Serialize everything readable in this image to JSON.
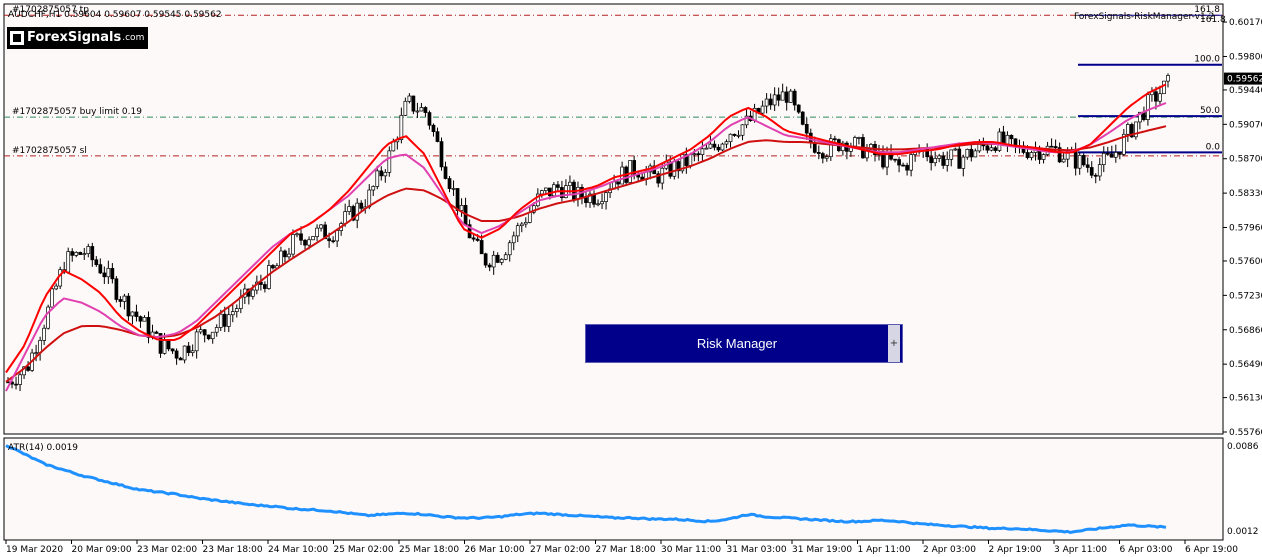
{
  "header": {
    "symbol_line": "AUDCHF,H1  0.59604 0.59607 0.59545 0.59562",
    "ea_label": "ForexSignals-RiskManager-v1.2",
    "ea_badge": "161.8"
  },
  "logo": {
    "text": "ForexSignals",
    "suffix": ".com"
  },
  "order_lines": [
    {
      "label": "#1702875057 tp",
      "price": 0.60244,
      "color": "#b22222"
    },
    {
      "label": "#1702875057 buy limit 0.19",
      "price": 0.59148,
      "color": "#2e8b57"
    },
    {
      "label": "#1702875057 sl",
      "price": 0.5873,
      "color": "#b22222"
    }
  ],
  "fib_levels": [
    {
      "label": "161.8",
      "price": 0.60244
    },
    {
      "label": "100.0",
      "price": 0.59711
    },
    {
      "label": "50.0",
      "price": 0.59158
    },
    {
      "label": "0.0",
      "price": 0.58768
    }
  ],
  "risk_manager": {
    "label": "Risk Manager",
    "plus": "+"
  },
  "indicator": {
    "label": "ATR(14) 0.0019",
    "max_label": "0.0086",
    "min_label": "0.0012"
  },
  "chart_data": {
    "type": "candlestick",
    "symbol": "AUDCHF,H1",
    "current_price": 0.59562,
    "current_price_label": "0.59562",
    "ylim": [
      0.5576,
      0.603
    ],
    "y_ticks": [
      "0.60170",
      "0.59800",
      "0.59440",
      "0.59070",
      "0.58700",
      "0.58330",
      "0.57960",
      "0.57600",
      "0.57230",
      "0.56860",
      "0.56490",
      "0.56130",
      "0.55760"
    ],
    "x_ticks": [
      "19 Mar 2020",
      "20 Mar 09:00",
      "23 Mar 02:00",
      "23 Mar 18:00",
      "24 Mar 10:00",
      "25 Mar 02:00",
      "25 Mar 18:00",
      "26 Mar 10:00",
      "27 Mar 02:00",
      "27 Mar 18:00",
      "30 Mar 11:00",
      "31 Mar 03:00",
      "31 Mar 19:00",
      "1 Apr 11:00",
      "2 Apr 03:00",
      "2 Apr 19:00",
      "3 Apr 11:00",
      "6 Apr 03:00",
      "6 Apr 19:00"
    ],
    "close_profile": [
      0.563,
      0.5645,
      0.57,
      0.576,
      0.577,
      0.575,
      0.572,
      0.5695,
      0.567,
      0.566,
      0.568,
      0.569,
      0.571,
      0.573,
      0.575,
      0.578,
      0.579,
      0.579,
      0.581,
      0.583,
      0.587,
      0.593,
      0.592,
      0.586,
      0.58,
      0.576,
      0.577,
      0.58,
      0.583,
      0.584,
      0.583,
      0.583,
      0.585,
      0.586,
      0.585,
      0.586,
      0.587,
      0.588,
      0.59,
      0.591,
      0.593,
      0.594,
      0.589,
      0.588,
      0.589,
      0.588,
      0.587,
      0.586,
      0.588,
      0.587,
      0.587,
      0.588,
      0.589,
      0.588,
      0.588,
      0.588,
      0.587,
      0.586,
      0.587,
      0.59,
      0.593,
      0.595
    ],
    "ema_fast_profile": [
      0.564,
      0.567,
      0.572,
      0.575,
      0.574,
      0.5725,
      0.57,
      0.5685,
      0.5675,
      0.5675,
      0.569,
      0.571,
      0.573,
      0.575,
      0.577,
      0.579,
      0.58,
      0.5815,
      0.5835,
      0.586,
      0.5885,
      0.5895,
      0.5875,
      0.5835,
      0.5795,
      0.5785,
      0.5795,
      0.5815,
      0.583,
      0.5835,
      0.5835,
      0.584,
      0.585,
      0.5855,
      0.586,
      0.587,
      0.588,
      0.5895,
      0.5915,
      0.5925,
      0.5915,
      0.59,
      0.5895,
      0.589,
      0.5885,
      0.588,
      0.5875,
      0.5875,
      0.5878,
      0.588,
      0.5885,
      0.5888,
      0.5888,
      0.5884,
      0.5882,
      0.5878,
      0.5876,
      0.5885,
      0.5905,
      0.5925,
      0.594,
      0.595
    ],
    "ema_mid_profile": [
      0.562,
      0.566,
      0.57,
      0.572,
      0.5715,
      0.5705,
      0.569,
      0.568,
      0.5678,
      0.5682,
      0.5695,
      0.5715,
      0.5735,
      0.5755,
      0.5775,
      0.579,
      0.58,
      0.5815,
      0.583,
      0.585,
      0.587,
      0.5875,
      0.586,
      0.583,
      0.58,
      0.579,
      0.5798,
      0.5812,
      0.5825,
      0.583,
      0.5832,
      0.5838,
      0.5846,
      0.5852,
      0.5858,
      0.5866,
      0.5875,
      0.5888,
      0.5905,
      0.5915,
      0.5905,
      0.5895,
      0.5892,
      0.5888,
      0.5884,
      0.588,
      0.5877,
      0.5877,
      0.588,
      0.5883,
      0.5886,
      0.5888,
      0.5886,
      0.5883,
      0.588,
      0.5877,
      0.5877,
      0.5885,
      0.5898,
      0.5912,
      0.5922,
      0.593
    ],
    "ema_slow_profile": [
      0.563,
      0.5645,
      0.5665,
      0.5682,
      0.569,
      0.569,
      0.5686,
      0.568,
      0.5678,
      0.568,
      0.5688,
      0.57,
      0.5715,
      0.5732,
      0.5748,
      0.5762,
      0.5775,
      0.5788,
      0.5802,
      0.5818,
      0.583,
      0.5838,
      0.5836,
      0.5826,
      0.5812,
      0.5803,
      0.5803,
      0.5808,
      0.5816,
      0.5822,
      0.5826,
      0.5832,
      0.5838,
      0.5844,
      0.585,
      0.5856,
      0.5862,
      0.587,
      0.588,
      0.5888,
      0.589,
      0.5888,
      0.5888,
      0.5886,
      0.5884,
      0.5882,
      0.588,
      0.588,
      0.5881,
      0.5882,
      0.5884,
      0.5886,
      0.5886,
      0.5884,
      0.5882,
      0.588,
      0.5879,
      0.5882,
      0.5888,
      0.5895,
      0.59,
      0.5905
    ],
    "atr_profile": [
      0.0086,
      0.0078,
      0.007,
      0.0065,
      0.006,
      0.0056,
      0.0052,
      0.0048,
      0.0046,
      0.0044,
      0.0041,
      0.0039,
      0.0037,
      0.0035,
      0.0034,
      0.0032,
      0.0031,
      0.003,
      0.0028,
      0.0026,
      0.0027,
      0.0028,
      0.0027,
      0.0025,
      0.0024,
      0.0024,
      0.0025,
      0.0027,
      0.0028,
      0.0027,
      0.0026,
      0.0025,
      0.0024,
      0.0024,
      0.0023,
      0.0023,
      0.0022,
      0.0021,
      0.0023,
      0.0027,
      0.0025,
      0.0024,
      0.0023,
      0.0022,
      0.0021,
      0.0021,
      0.0022,
      0.0021,
      0.0019,
      0.0018,
      0.0017,
      0.0016,
      0.0015,
      0.0015,
      0.0014,
      0.0013,
      0.0012,
      0.0014,
      0.0016,
      0.0018,
      0.0017,
      0.0016
    ],
    "atr_ylim": [
      0.0012,
      0.0086
    ],
    "colors": {
      "bull": "#ffffff",
      "bear": "#000000",
      "ema_fast": "#ff0000",
      "ema_mid": "#e040b0",
      "ema_slow": "#d01010",
      "atr": "#1e90ff",
      "fib": "#00008b"
    }
  }
}
